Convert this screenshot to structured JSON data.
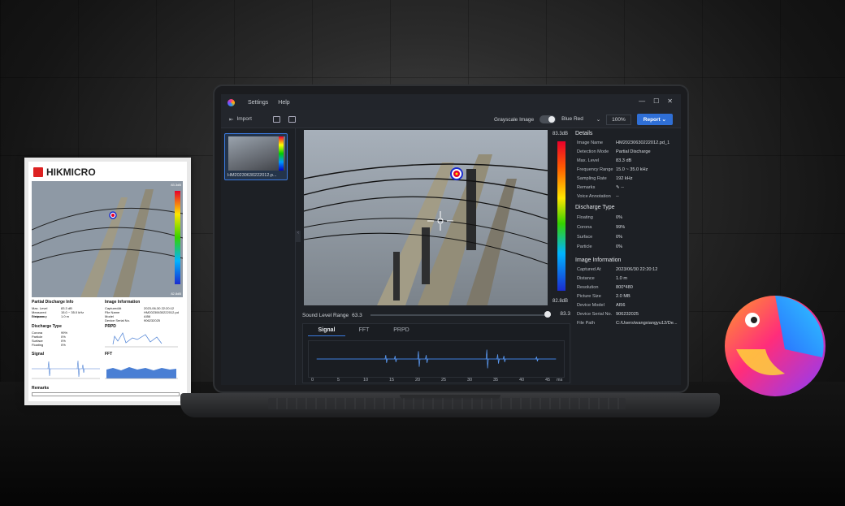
{
  "app": {
    "menus": [
      "Settings",
      "Help"
    ],
    "window_buttons": [
      "—",
      "☐",
      "✕"
    ]
  },
  "toolbar": {
    "import_label": "Import",
    "grayscale_label": "Grayscale Image",
    "palette": "Blue Red",
    "zoom": "100%",
    "report_label": "Report"
  },
  "files": [
    {
      "name": "HM20230630222012.p..."
    }
  ],
  "viewer": {
    "scale_max": "83.3dB",
    "scale_min": "82.8dB",
    "sound_level_label": "Sound Level Range",
    "sound_level_min": "63.3",
    "sound_level_max": "83.3"
  },
  "signal": {
    "tabs": [
      "Signal",
      "FFT",
      "PRPD"
    ],
    "active_tab": "Signal",
    "x_ticks": [
      "0",
      "5",
      "10",
      "15",
      "20",
      "25",
      "30",
      "35",
      "40",
      "45"
    ],
    "x_unit": "ms"
  },
  "details": {
    "title": "Details",
    "rows": [
      {
        "k": "Image Name",
        "v": "HM20230630222012.pd_1"
      },
      {
        "k": "Detection Mode",
        "v": "Partial Discharge"
      },
      {
        "k": "Max. Level",
        "v": "83.3 dB"
      },
      {
        "k": "Frequency Range",
        "v": "15.0 ~ 35.0 kHz"
      },
      {
        "k": "Sampling Rate",
        "v": "192 kHz"
      },
      {
        "k": "Remarks",
        "v": "--"
      },
      {
        "k": "Voice Annotation",
        "v": "--"
      }
    ],
    "discharge_title": "Discharge Type",
    "discharge": [
      {
        "k": "Floating",
        "v": "0%"
      },
      {
        "k": "Corona",
        "v": "99%"
      },
      {
        "k": "Surface",
        "v": "0%"
      },
      {
        "k": "Particle",
        "v": "0%"
      }
    ],
    "info_title": "Image Information",
    "info": [
      {
        "k": "Captured At",
        "v": "2023/06/30 22:20:12"
      },
      {
        "k": "Distance",
        "v": "1.0 m"
      },
      {
        "k": "Resolution",
        "v": "800*480"
      },
      {
        "k": "Picture Size",
        "v": "2.0 MB"
      },
      {
        "k": "Device Model",
        "v": "AI56"
      },
      {
        "k": "Device Serial No.",
        "v": "906232025"
      },
      {
        "k": "File Path",
        "v": "C:/Users/wangxiangyu12/De..."
      }
    ]
  },
  "paper": {
    "brand": "HIKMICRO",
    "scale_max": "83.3dB",
    "scale_min": "82.8dB",
    "pd_title": "Partial Discharge Info",
    "pd_rows": [
      {
        "k": "Max. Level",
        "v": "83.3 dB"
      },
      {
        "k": "Measured Frequency",
        "v": "15.0 ~ 35.0 kHz"
      },
      {
        "k": "Distance",
        "v": "1.0 m"
      }
    ],
    "img_title": "Image Information",
    "img_rows": [
      {
        "k": "CapturedAt",
        "v": "2023-06-30 22:20:12"
      },
      {
        "k": "File Name",
        "v": "HM20230630222012.pd"
      },
      {
        "k": "Model",
        "v": "AI56"
      },
      {
        "k": "Device Serial No.",
        "v": "906232025"
      }
    ],
    "dt_title": "Discharge Type",
    "dt_rows": [
      {
        "k": "Corona",
        "v": "99%"
      },
      {
        "k": "Particle",
        "v": "0%"
      },
      {
        "k": "Surface",
        "v": "0%"
      },
      {
        "k": "Floating",
        "v": "0%"
      }
    ],
    "prpd_title": "PRPD",
    "signal_title": "Signal",
    "fft_title": "FFT",
    "remarks_title": "Remarks"
  },
  "colors": {
    "accent": "#2f6fd6",
    "panel": "#1d2025"
  }
}
